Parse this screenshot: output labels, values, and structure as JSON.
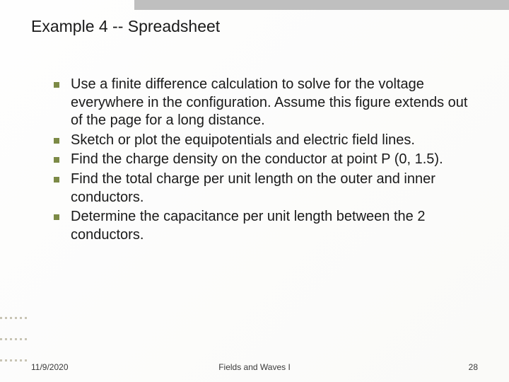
{
  "title": "Example 4 -- Spreadsheet",
  "bullets": [
    "Use a finite difference calculation to solve for the voltage everywhere in the configuration. Assume this figure extends out of the page for a long distance.",
    "Sketch or plot the equipotentials and electric field lines.",
    "Find the charge density on the conductor at point P (0, 1.5).",
    "Find the total charge per unit length on the outer and inner conductors.",
    "Determine the capacitance per unit length between the 2 conductors."
  ],
  "footer": {
    "date": "11/9/2020",
    "course": "Fields and Waves I",
    "page": "28"
  }
}
